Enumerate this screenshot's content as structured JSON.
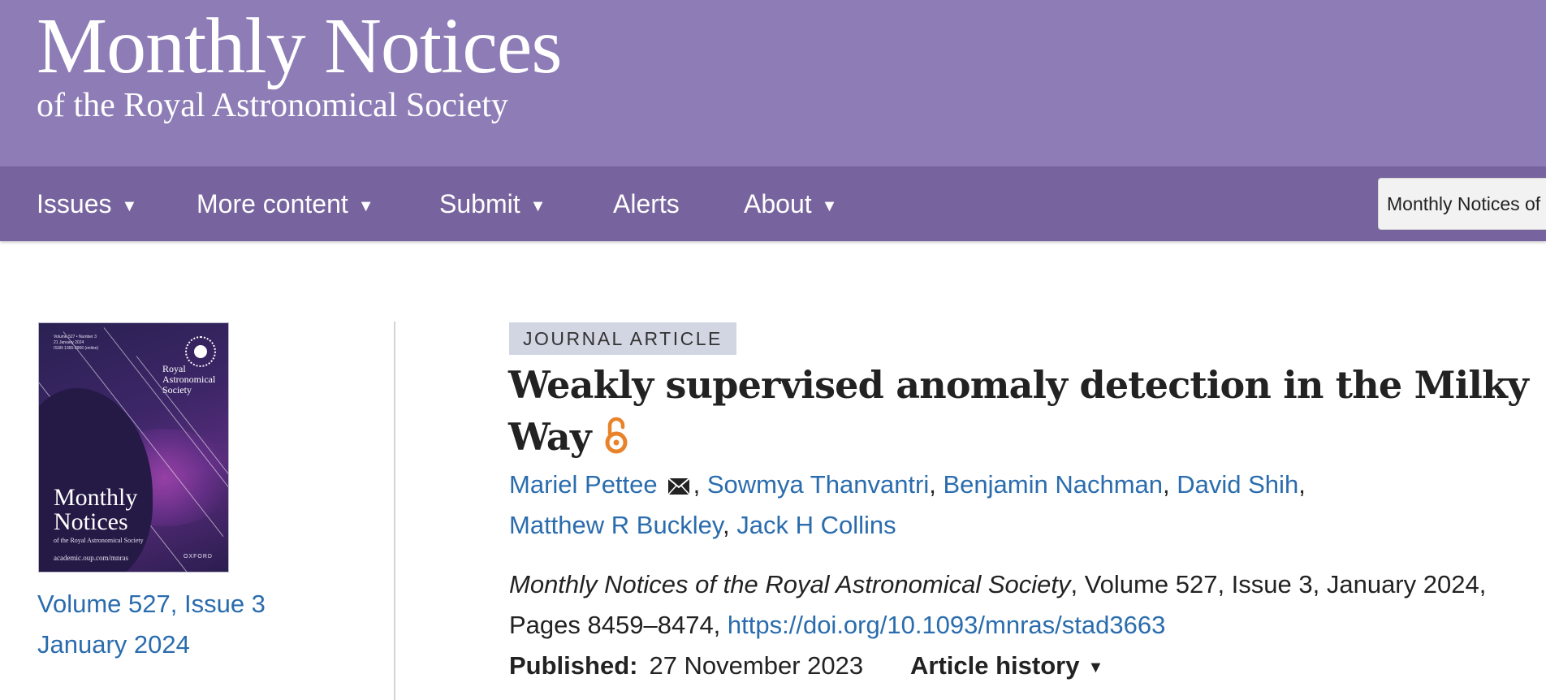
{
  "masthead": {
    "title": "Monthly Notices",
    "subtitle": "of the Royal Astronomical Society"
  },
  "nav": {
    "items": [
      {
        "label": "Issues",
        "has_dropdown": true
      },
      {
        "label": "More content",
        "has_dropdown": true
      },
      {
        "label": "Submit",
        "has_dropdown": true
      },
      {
        "label": "Alerts",
        "has_dropdown": false
      },
      {
        "label": "About",
        "has_dropdown": true
      }
    ],
    "caret": "▼",
    "search_scope": "Monthly Notices of t"
  },
  "cover": {
    "small_text": [
      "Volume 527 • Number 3",
      "21 January 2024",
      "ISSN 1365-2966 (online)"
    ],
    "society": [
      "Royal",
      "Astronomical",
      "Society"
    ],
    "title_lines": [
      "Monthly",
      "Notices"
    ],
    "subtitle": "of the Royal Astronomical Society",
    "url": "academic.oup.com/mnras",
    "publisher": "OXFORD"
  },
  "issue": {
    "volume_issue": "Volume 527, Issue 3",
    "date": "January 2024"
  },
  "article": {
    "type_badge": "JOURNAL ARTICLE",
    "title_lines": [
      "Weakly supervised anomaly detection in the Milky",
      "Way"
    ],
    "open_access_icon": "open-access-lock-icon",
    "authors": [
      "Mariel Pettee",
      "Sowmya Thanvantri",
      "Benjamin Nachman",
      "David Shih",
      "Matthew R Buckley",
      "Jack H Collins"
    ],
    "corresponding_icon": "envelope-icon",
    "journal": "Monthly Notices of the Royal Astronomical Society",
    "citation_rest": ", Volume 527, Issue 3, January 2024,",
    "pages": "Pages 8459–8474, ",
    "doi": "https://doi.org/10.1093/mnras/stad3663",
    "published_label": "Published:",
    "published_date": "27 November 2023",
    "history_label": "Article history",
    "history_caret": "▼"
  },
  "colors": {
    "masthead": "#8d7cb6",
    "navbar": "#77649e",
    "link": "#2a6cad",
    "badge": "#d2d6e3",
    "open_access": "#e8832a"
  }
}
